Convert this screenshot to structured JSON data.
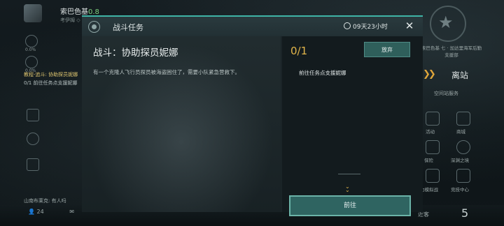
{
  "player": {
    "name": "索巴色基",
    "level": "0.8",
    "sub": "考伊姆 ◇"
  },
  "left_hud": {
    "labels": [
      "0.0%",
      "0.0%"
    ],
    "tasks": [
      "教程-追斗: 协助探员妮娜",
      "0/1  前往任务点支援妮娜"
    ],
    "chat": "山南布莱克: 有人吗",
    "stat": "24"
  },
  "right_hud": {
    "station_text": "索巴色基 七 · 加达里海军后勤支援部",
    "depart_label": "离站",
    "station_service": "空间站服务",
    "items": [
      {
        "label": "活动"
      },
      {
        "label": "商城"
      },
      {
        "label": "保险"
      },
      {
        "label": "深渊之境"
      },
      {
        "label": "力模拟战"
      },
      {
        "label": "竞技中心"
      }
    ],
    "bottom_left": "近客",
    "bottom_number": "5"
  },
  "dialog": {
    "title": "战斗任务",
    "timer": "09天23小时",
    "mission_title": "战斗：协助探员妮娜",
    "description": "有一个克隆人飞行员探员被海盗困住了，需要小队紧急营救下。",
    "progress": "0/1",
    "abandon_label": "放弃",
    "objective": "前往任务点支援妮娜",
    "goto_label": "前往"
  },
  "colors": {
    "accent": "#3fb4a6",
    "progress": "#e2b54a",
    "button": "#2f6461"
  }
}
